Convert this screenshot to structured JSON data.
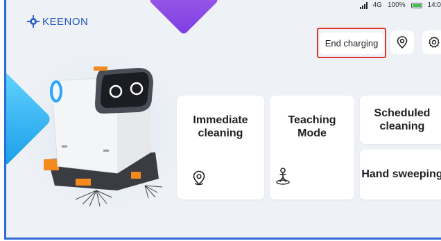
{
  "brand": {
    "name": "KEENON"
  },
  "status_bar": {
    "network": "4G",
    "battery": "100%",
    "time": "14:0"
  },
  "header": {
    "end_charging_label": "End charging",
    "location_icon": "location-pin-icon",
    "settings_icon": "gear-icon"
  },
  "modes": [
    {
      "label_line1": "Immediate",
      "label_line2": "cleaning",
      "icon": "location-pin-icon"
    },
    {
      "label_line1": "Teaching",
      "label_line2": "Mode",
      "icon": "teaching-walker-icon"
    },
    {
      "label_line1": "Scheduled",
      "label_line2": "cleaning"
    },
    {
      "label": "Hand sweeping"
    }
  ],
  "colors": {
    "accent_blue": "#2f6bd6",
    "highlight_red": "#e0352b",
    "background": "#eef1f6"
  }
}
